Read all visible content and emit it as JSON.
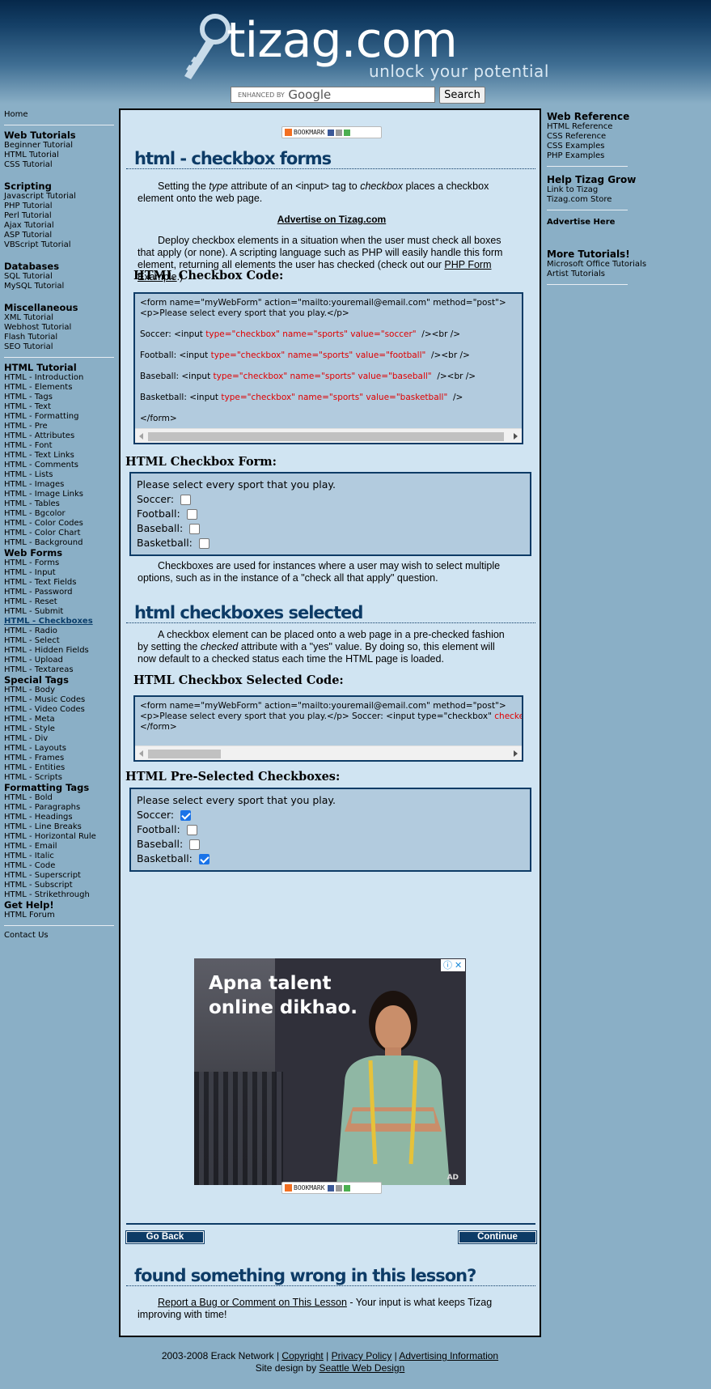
{
  "header": {
    "logo_text": "tizag.com",
    "tagline": "unlock your potential",
    "search": {
      "placeholder_prefix": "ENHANCED BY",
      "placeholder_brand": "Google",
      "button_label": "Search"
    }
  },
  "left_nav": {
    "home": "Home",
    "web_tutorials": {
      "heading": "Web Tutorials",
      "items": [
        "Beginner Tutorial",
        "HTML Tutorial",
        "CSS Tutorial"
      ]
    },
    "scripting": {
      "heading": "Scripting",
      "items": [
        "Javascript Tutorial",
        "PHP Tutorial",
        "Perl Tutorial",
        "Ajax Tutorial",
        "ASP Tutorial",
        "VBScript Tutorial"
      ]
    },
    "databases": {
      "heading": "Databases",
      "items": [
        "SQL Tutorial",
        "MySQL Tutorial"
      ]
    },
    "miscellaneous": {
      "heading": "Miscellaneous",
      "items": [
        "XML Tutorial",
        "Webhost Tutorial",
        "Flash Tutorial",
        "SEO Tutorial"
      ]
    },
    "html_tutorial": {
      "heading": "HTML Tutorial",
      "items": [
        "HTML - Introduction",
        "HTML - Elements",
        "HTML - Tags",
        "HTML - Text",
        "HTML - Formatting",
        "HTML - Pre",
        "HTML - Attributes",
        "HTML - Font",
        "HTML - Text Links",
        "HTML - Comments",
        "HTML - Lists",
        "HTML - Images",
        "HTML - Image Links",
        "HTML - Tables",
        "HTML - Bgcolor",
        "HTML - Color Codes",
        "HTML - Color Chart",
        "HTML - Background"
      ]
    },
    "web_forms": {
      "heading": "Web Forms",
      "items": [
        "HTML - Forms",
        "HTML - Input",
        "HTML - Text Fields",
        "HTML - Password",
        "HTML - Reset",
        "HTML - Submit"
      ],
      "active": "HTML - Checkboxes",
      "items_after": [
        "HTML - Radio",
        "HTML - Select",
        "HTML - Hidden Fields",
        "HTML - Upload",
        "HTML - Textareas"
      ]
    },
    "special_tags": {
      "heading": "Special Tags",
      "items": [
        "HTML - Body",
        "HTML - Music Codes",
        "HTML - Video Codes",
        "HTML - Meta",
        "HTML - Style",
        "HTML - Div",
        "HTML - Layouts",
        "HTML - Frames",
        "HTML - Entities",
        "HTML - Scripts"
      ]
    },
    "formatting_tags": {
      "heading": "Formatting Tags",
      "items": [
        "HTML - Bold",
        "HTML - Paragraphs",
        "HTML - Headings",
        "HTML - Line Breaks",
        "HTML - Horizontal Rule",
        "HTML - Email",
        "HTML - Italic",
        "HTML - Code",
        "HTML - Superscript",
        "HTML - Subscript",
        "HTML - Strikethrough"
      ]
    },
    "get_help": {
      "heading": "Get Help!",
      "items": [
        "HTML Forum"
      ]
    },
    "contact": "Contact Us"
  },
  "right_nav": {
    "web_reference": {
      "heading": "Web Reference",
      "items": [
        "HTML Reference",
        "CSS Reference",
        "CSS Examples",
        "PHP Examples"
      ]
    },
    "help_grow": {
      "heading": "Help Tizag Grow",
      "items": [
        "Link to Tizag",
        "Tizag.com Store"
      ]
    },
    "advertise": "Advertise Here",
    "more_tutorials": {
      "heading": "More Tutorials!",
      "items": [
        "Microsoft Office Tutorials",
        "Artist Tutorials"
      ]
    }
  },
  "main": {
    "bookmark_label": "BOOKMARK",
    "title1": "html - checkbox forms",
    "p1_a": "Setting the ",
    "p1_em": "type",
    "p1_b": " attribute of an <input> tag to ",
    "p1_em2": "checkbox",
    "p1_c": " places a checkbox element onto the web page.",
    "advertise_link": "Advertise on Tizag.com",
    "p2_a": "Deploy checkbox elements in a situation when the user must check all boxes that apply (or none). A scripting language such as PHP will easily handle this form element, returning all elements the user has checked (check out our ",
    "p2_link": "PHP Form Example",
    "p2_b": ".)",
    "code1_heading": "HTML Checkbox Code:",
    "code1": {
      "line1": "<form name=\"myWebForm\" action=\"mailto:youremail@email.com\" method=\"post\">",
      "line2": "<p>Please select every sport that you play.</p>",
      "rows": [
        {
          "pre": "Soccer: <input ",
          "attr": "type=\"checkbox\" name=\"sports\" value=\"soccer\"",
          "post": "  /><br />"
        },
        {
          "pre": "Football: <input ",
          "attr": "type=\"checkbox\" name=\"sports\" value=\"football\"",
          "post": "  /><br />"
        },
        {
          "pre": "Baseball: <input ",
          "attr": "type=\"checkbox\" name=\"sports\" value=\"baseball\"",
          "post": "  /><br />"
        },
        {
          "pre": "Basketball: <input ",
          "attr": "type=\"checkbox\" name=\"sports\" value=\"basketball\"",
          "post": "  />"
        }
      ],
      "close": "</form>"
    },
    "form1_heading": "HTML Checkbox Form:",
    "form1": {
      "prompt": "Please select every sport that you play.",
      "options": [
        {
          "label": "Soccer:",
          "checked": false
        },
        {
          "label": "Football:",
          "checked": false
        },
        {
          "label": "Baseball:",
          "checked": false
        },
        {
          "label": "Basketball:",
          "checked": false
        }
      ]
    },
    "p3": "Checkboxes are used for instances where a user may wish to select multiple options, such as in the instance of a \"check all that apply\" question.",
    "title2": "html checkboxes selected",
    "p4_a": "A checkbox element can be placed onto a web page in a pre-checked fashion by setting the ",
    "p4_em": "checked",
    "p4_b": " attribute with a \"yes\" value. By doing so, this element will now default to a checked status each time the HTML page is loaded.",
    "code2_heading": "HTML Checkbox Selected Code:",
    "code2": {
      "line1": "<form name=\"myWebForm\" action=\"mailto:youremail@email.com\" method=\"post\">",
      "line2_pre": "<p>Please select every sport that you play.</p> Soccer: <input type=\"checkbox\" ",
      "line2_red": "checked=\"yes\"",
      "line3": "</form>"
    },
    "form2_heading": "HTML Pre-Selected Checkboxes:",
    "form2": {
      "prompt": "Please select every sport that you play.",
      "options": [
        {
          "label": "Soccer:",
          "checked": true
        },
        {
          "label": "Football:",
          "checked": false
        },
        {
          "label": "Baseball:",
          "checked": false
        },
        {
          "label": "Basketball:",
          "checked": true
        }
      ]
    },
    "ad": {
      "headline_1": "Apna talent",
      "headline_2": "online dikhao.",
      "label": "AD"
    },
    "go_back": "Go Back",
    "continue": "Continue",
    "title3": "found something wrong in this lesson?",
    "report_link": "Report a Bug or Comment on This Lesson",
    "report_text": " - Your input is what keeps Tizag improving with time!"
  },
  "footer": {
    "copyright": "2003-2008 Erack Network | ",
    "links": [
      "Copyright",
      "Privacy Policy",
      "Advertising Information"
    ],
    "design_pre": "Site design by ",
    "design_link": "Seattle Web Design"
  },
  "colors": {
    "page_bg": "#8aafc6",
    "content_bg": "#d0e4f2",
    "code_bg": "#b2cbde",
    "accent": "#0d3b66",
    "code_attr": "#e00000"
  }
}
